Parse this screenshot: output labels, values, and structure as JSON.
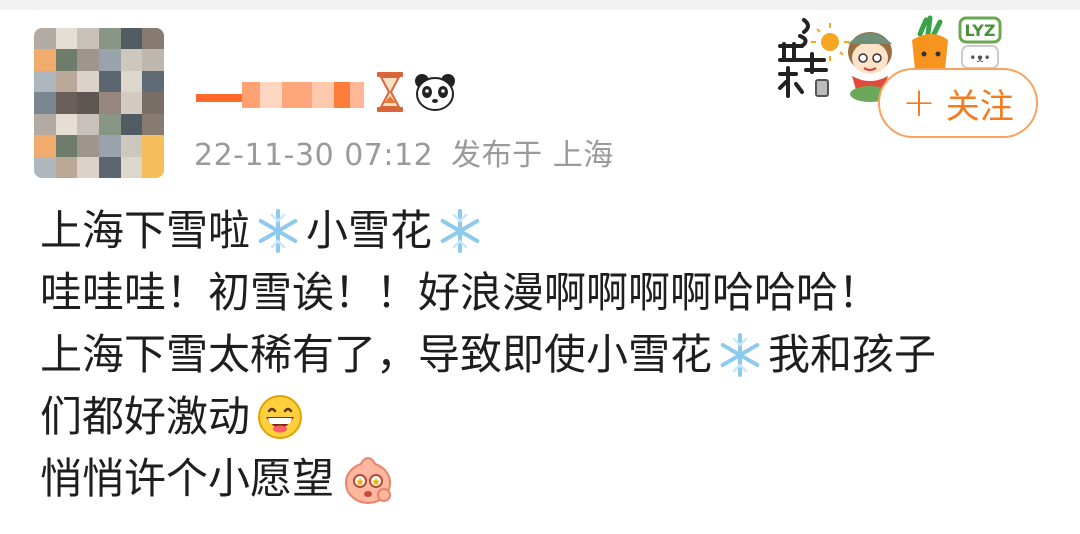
{
  "post": {
    "author": {
      "username": "",
      "avatar_label": "avatar"
    },
    "timestamp": "22-11-30 07:12",
    "location_text": "发布于 上海",
    "follow_button": {
      "label": "关注",
      "icon": "plus-icon"
    },
    "text_lines": [
      [
        "上海下雪啦",
        "小雪花"
      ],
      [
        "哇哇哇！初雪诶！！好浪漫啊啊啊啊哈哈哈！"
      ],
      [
        "上海下雪太稀有了，导致即使小雪花",
        "我和孩子"
      ],
      [
        "们都好激动"
      ],
      [
        "悄悄许个小愿望"
      ]
    ],
    "icons": {
      "badge_1": "hourglass-icon",
      "badge_2": "panda-icon",
      "snowflake": "snowflake-emoji",
      "grin": "grinning-emoji",
      "wish": "wishing-emoji",
      "sticker_decoration": "drink-hot-water-sticker"
    },
    "accent_color": "#f47b20"
  }
}
